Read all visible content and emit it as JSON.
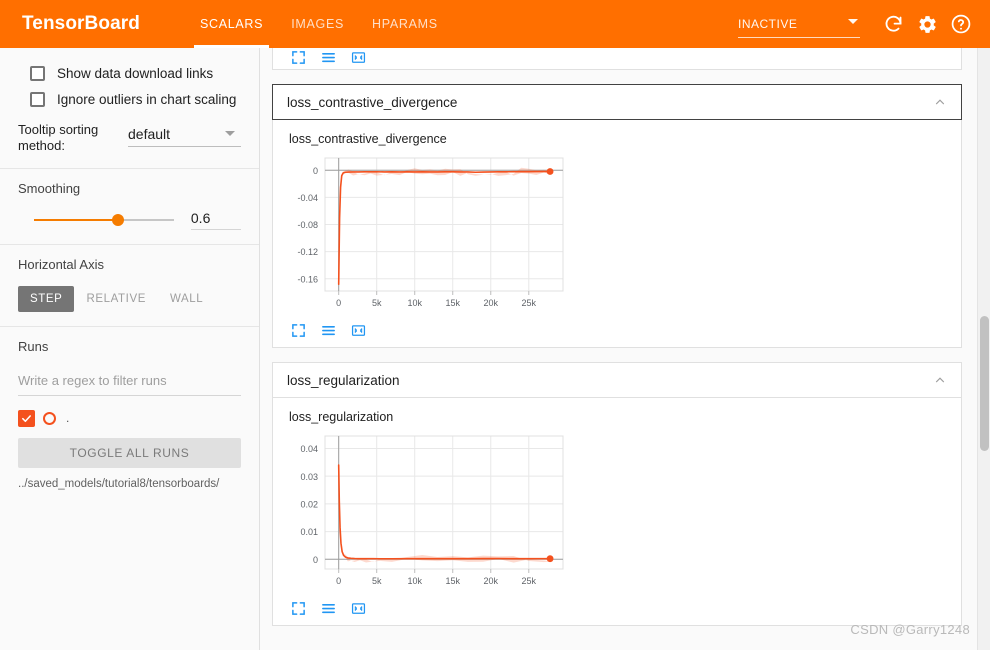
{
  "header": {
    "brand": "TensorBoard",
    "tabs": [
      {
        "label": "SCALARS",
        "active": true
      },
      {
        "label": "IMAGES",
        "active": false
      },
      {
        "label": "HPARAMS",
        "active": false
      }
    ],
    "status": "INACTIVE",
    "accent_color": "#ff6f00",
    "icons": [
      "refresh-icon",
      "settings-gear-icon",
      "help-question-icon"
    ]
  },
  "sidebar": {
    "checkboxes": [
      {
        "label": "Show data download links",
        "checked": false
      },
      {
        "label": "Ignore outliers in chart scaling",
        "checked": false
      }
    ],
    "tooltip": {
      "label": "Tooltip sorting method:",
      "value": "default"
    },
    "smoothing": {
      "title": "Smoothing",
      "value": "0.6"
    },
    "horizontal_axis": {
      "title": "Horizontal Axis",
      "options": [
        {
          "label": "STEP",
          "selected": true
        },
        {
          "label": "RELATIVE",
          "selected": false
        },
        {
          "label": "WALL",
          "selected": false
        }
      ]
    },
    "runs": {
      "title": "Runs",
      "filter_placeholder": "Write a regex to filter runs",
      "filter_value": "",
      "run_label": ".",
      "run_checked": true,
      "run_color": "#f4511e",
      "toggle_all_label": "TOGGLE ALL RUNS",
      "path": "../saved_models/tutorial8/tensorboards/"
    }
  },
  "main": {
    "chart_toolbar_icons": [
      "expand-fullscreen-icon",
      "data-table-icon",
      "fit-domain-icon"
    ],
    "cards": [
      {
        "title": "loss_contrastive_divergence",
        "expanded": true,
        "focused": true
      },
      {
        "title": "loss_regularization",
        "expanded": true,
        "focused": false
      }
    ]
  },
  "watermark": "CSDN @Garry1248",
  "chart_data": [
    {
      "type": "line",
      "title": "loss_contrastive_divergence",
      "xlabel": "",
      "ylabel": "",
      "xlim": [
        -1800,
        29500
      ],
      "ylim": [
        -0.178,
        0.018
      ],
      "xticks": [
        0,
        5000,
        10000,
        15000,
        20000,
        25000
      ],
      "xticklabels": [
        "0",
        "5k",
        "10k",
        "15k",
        "20k",
        "25k"
      ],
      "yticks": [
        0,
        -0.04,
        -0.08,
        -0.12,
        -0.16
      ],
      "yticklabels": [
        "0",
        "-0.04",
        "-0.08",
        "-0.12",
        "-0.16"
      ],
      "grid": true,
      "line_color": "#f4511e",
      "series": [
        {
          "name": "../saved_models/tutorial8/tensorboards/",
          "x": [
            0,
            120,
            250,
            400,
            600,
            900,
            1300,
            1900,
            2600,
            3400,
            4200,
            5000,
            6000,
            7000,
            8000,
            9000,
            10000,
            11000,
            12000,
            13000,
            14000,
            15000,
            16000,
            17000,
            18000,
            19000,
            20000,
            21000,
            22000,
            23000,
            24000,
            25000,
            26000,
            27000,
            27800
          ],
          "y": [
            -0.168,
            -0.07,
            -0.025,
            -0.008,
            -0.004,
            -0.003,
            -0.0028,
            -0.0026,
            -0.0025,
            -0.0024,
            -0.0024,
            -0.0023,
            -0.0025,
            -0.0024,
            -0.0026,
            -0.0024,
            -0.0025,
            -0.0024,
            -0.0026,
            -0.0025,
            -0.0024,
            -0.0023,
            -0.0025,
            -0.0026,
            -0.003,
            -0.0028,
            -0.0026,
            -0.0024,
            -0.0023,
            -0.0022,
            -0.0021,
            -0.0021,
            -0.002,
            -0.002,
            -0.0019
          ]
        }
      ],
      "endpoint_marker": true
    },
    {
      "type": "line",
      "title": "loss_regularization",
      "xlabel": "",
      "ylabel": "",
      "xlim": [
        -1800,
        29500
      ],
      "ylim": [
        -0.0035,
        0.0445
      ],
      "xticks": [
        0,
        5000,
        10000,
        15000,
        20000,
        25000
      ],
      "xticklabels": [
        "0",
        "5k",
        "10k",
        "15k",
        "20k",
        "25k"
      ],
      "yticks": [
        0.04,
        0.03,
        0.02,
        0.01,
        0
      ],
      "yticklabels": [
        "0.04",
        "0.03",
        "0.02",
        "0.01",
        "0"
      ],
      "grid": true,
      "line_color": "#f4511e",
      "series": [
        {
          "name": "../saved_models/tutorial8/tensorboards/",
          "x": [
            0,
            80,
            180,
            300,
            450,
            650,
            900,
            1200,
            1600,
            2100,
            2800,
            3600,
            4500,
            5500,
            7000,
            9000,
            11000,
            13000,
            15000,
            17000,
            19000,
            21000,
            23000,
            25000,
            27000,
            27800
          ],
          "y": [
            0.034,
            0.021,
            0.0115,
            0.0058,
            0.0028,
            0.0014,
            0.0008,
            0.0005,
            0.00035,
            0.00028,
            0.00024,
            0.00022,
            0.00021,
            0.0002,
            0.0002,
            0.00021,
            0.00022,
            0.00022,
            0.00023,
            0.00024,
            0.00025,
            0.00025,
            0.00024,
            0.00023,
            0.00022,
            0.00022
          ]
        }
      ],
      "endpoint_marker": true
    }
  ]
}
